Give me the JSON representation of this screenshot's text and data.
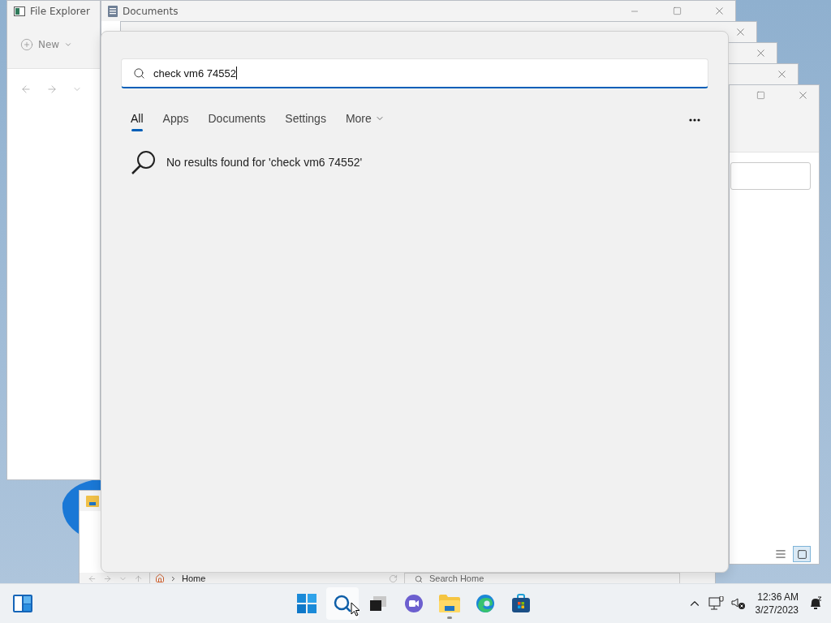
{
  "file_explorer": {
    "title": "File Explorer",
    "new_button": "New"
  },
  "documents_window": {
    "title": "Documents"
  },
  "side_window": {
    "view_buttons": [
      {
        "kind": "details",
        "selected": false
      },
      {
        "kind": "tiles",
        "selected": true
      }
    ]
  },
  "home_window": {
    "address": "Home",
    "search_placeholder": "Search Home"
  },
  "search": {
    "query": "check vm6 74552",
    "tabs": [
      {
        "label": "All",
        "kind": "plain",
        "selected": true
      },
      {
        "label": "Apps",
        "kind": "plain",
        "selected": false
      },
      {
        "label": "Documents",
        "kind": "plain",
        "selected": false
      },
      {
        "label": "Settings",
        "kind": "plain",
        "selected": false
      },
      {
        "label": "More",
        "kind": "dropdown",
        "selected": false
      }
    ],
    "message": "No results found for 'check vm6 74552'"
  },
  "taskbar": {
    "apps": [
      {
        "kind": "start",
        "active": false,
        "running": false
      },
      {
        "kind": "search",
        "active": true,
        "running": false
      },
      {
        "kind": "task-view",
        "active": false,
        "running": false
      },
      {
        "kind": "chat",
        "active": false,
        "running": false
      },
      {
        "kind": "explorer",
        "active": false,
        "running": true
      },
      {
        "kind": "edge",
        "active": false,
        "running": false
      },
      {
        "kind": "store",
        "active": false,
        "running": false
      }
    ],
    "time": "12:36 AM",
    "date": "3/27/2023"
  }
}
